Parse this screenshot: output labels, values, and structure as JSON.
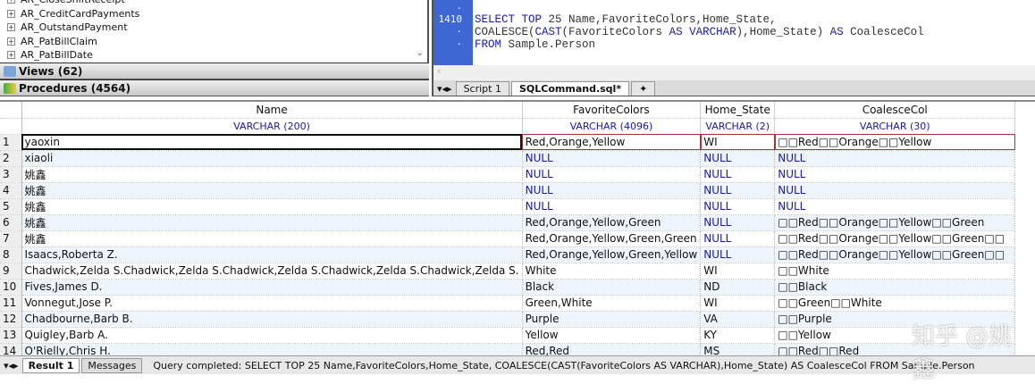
{
  "tree": {
    "items": [
      "AR_CloseShiftReceipt",
      "AR_CreditCardPayments",
      "AR_OutstandPayment",
      "AR_PatBillClaim",
      "AR_PatBillDate"
    ],
    "views": "Views (62)",
    "procedures": "Procedures (4564)"
  },
  "editor": {
    "line_number": "1410",
    "code": [
      [
        {
          "t": "SELECT TOP",
          "k": 1
        },
        {
          "t": " 25 Name,FavoriteColors,Home_State,",
          "k": 0
        }
      ],
      [
        {
          "t": "COALESCE(",
          "k": 0
        },
        {
          "t": "CAST",
          "k": 1
        },
        {
          "t": "(FavoriteColors ",
          "k": 0
        },
        {
          "t": "AS VARCHAR",
          "k": 1
        },
        {
          "t": "),Home_State) ",
          "k": 0
        },
        {
          "t": "AS",
          "k": 1
        },
        {
          "t": " CoalesceCol",
          "k": 0
        }
      ],
      [
        {
          "t": "FROM",
          "k": 1
        },
        {
          "t": " Sample.Person",
          "k": 0
        }
      ]
    ],
    "tabs": [
      "Script 1",
      "SQLCommand.sql*"
    ]
  },
  "grid": {
    "columns": [
      {
        "name": "Name",
        "type": "VARCHAR (200)"
      },
      {
        "name": "FavoriteColors",
        "type": "VARCHAR (4096)"
      },
      {
        "name": "Home_State",
        "type": "VARCHAR (2)"
      },
      {
        "name": "CoalesceCol",
        "type": "VARCHAR (30)"
      }
    ],
    "rows": [
      [
        "1",
        "yaoxin",
        "Red,Orange,Yellow",
        "WI",
        "□□Red□□Orange□□Yellow"
      ],
      [
        "2",
        "xiaoli",
        "NULL",
        "NULL",
        "NULL"
      ],
      [
        "3",
        "姚鑫",
        "NULL",
        "NULL",
        "NULL"
      ],
      [
        "4",
        "姚鑫",
        "NULL",
        "NULL",
        "NULL"
      ],
      [
        "5",
        "姚鑫",
        "NULL",
        "NULL",
        "NULL"
      ],
      [
        "6",
        "姚鑫",
        "Red,Orange,Yellow,Green",
        "NULL",
        "□□Red□□Orange□□Yellow□□Green"
      ],
      [
        "7",
        "姚鑫",
        "Red,Orange,Yellow,Green,Green",
        "NULL",
        "□□Red□□Orange□□Yellow□□Green□□"
      ],
      [
        "8",
        "Isaacs,Roberta Z.",
        "Red,Orange,Yellow,Green,Yellow",
        "NULL",
        "□□Red□□Orange□□Yellow□□Green□□"
      ],
      [
        "9",
        "Chadwick,Zelda S.Chadwick,Zelda S.Chadwick,Zelda S.Chadwick,Zelda S.Chadwick,Zelda S.",
        "White",
        "WI",
        "□□White"
      ],
      [
        "10",
        "Fives,James D.",
        "Black",
        "ND",
        "□□Black"
      ],
      [
        "11",
        "Vonnegut,Jose P.",
        "Green,White",
        "WI",
        "□□Green□□White"
      ],
      [
        "12",
        "Chadbourne,Barb B.",
        "Purple",
        "VA",
        "□□Purple"
      ],
      [
        "13",
        "Quigley,Barb A.",
        "Yellow",
        "KY",
        "□□Yellow"
      ],
      [
        "14",
        "O'Rielly,Chris H.",
        "Red,Red",
        "MS",
        "□□Red□□Red"
      ]
    ]
  },
  "status": {
    "tabs": [
      "Result 1",
      "Messages"
    ],
    "message": "Query completed: SELECT TOP 25 Name,FavoriteColors,Home_State,  COALESCE(CAST(FavoriteColors AS VARCHAR),Home_State) AS CoalesceCol  FROM Sample.Person"
  },
  "watermark": "知乎 @姚鑫"
}
